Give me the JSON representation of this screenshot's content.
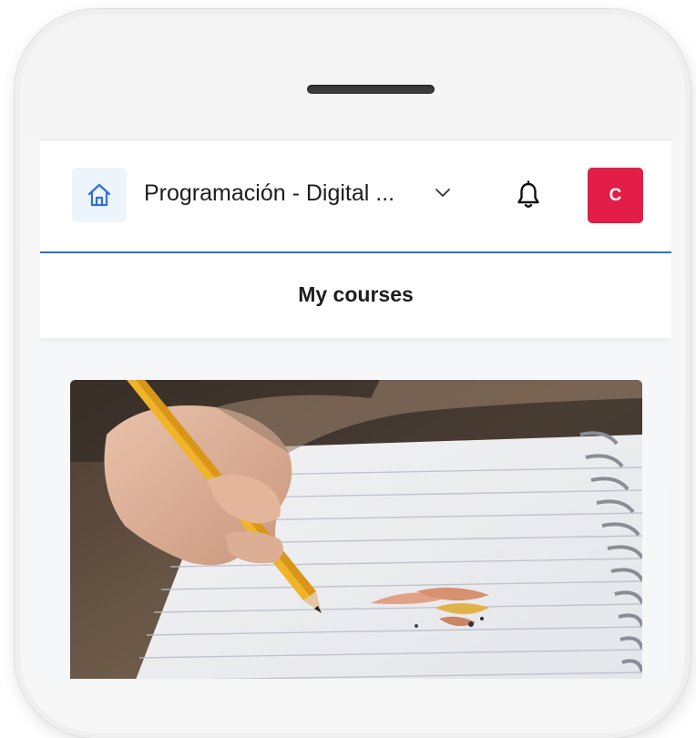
{
  "header": {
    "course_selector_label": "Programación - Digital ...",
    "avatar_initial": "C"
  },
  "subnav": {
    "title": "My courses"
  },
  "colors": {
    "accent_blue": "#2f6fd6",
    "avatar_red": "#e11d48",
    "home_button_bg": "#eef4fc"
  },
  "icons": [
    "home-icon",
    "chevron-down-icon",
    "bell-icon"
  ]
}
